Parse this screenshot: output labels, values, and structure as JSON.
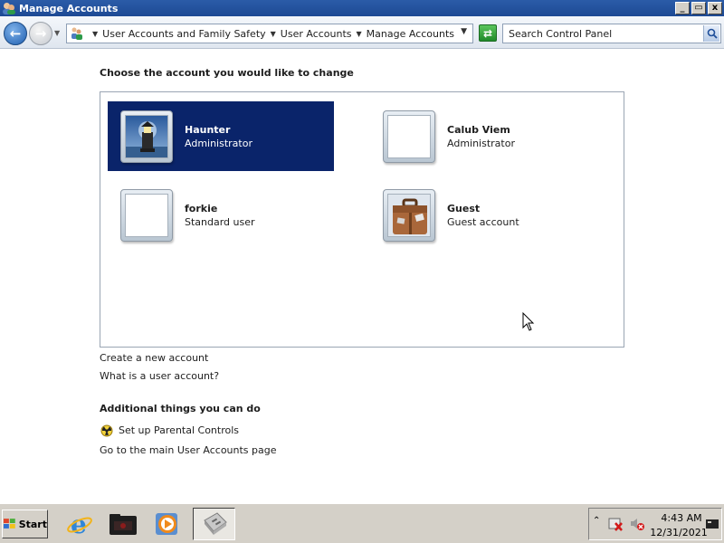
{
  "window": {
    "title": "Manage Accounts",
    "controls": {
      "minimize": "_",
      "restore": "▭",
      "close": "x"
    }
  },
  "address": {
    "breadcrumbs": [
      "User Accounts and Family Safety",
      "User Accounts",
      "Manage Accounts"
    ],
    "search_placeholder": "Search Control Panel"
  },
  "main": {
    "heading": "Choose the account you would like to change",
    "accounts": [
      {
        "name": "Haunter",
        "type": "Administrator",
        "picture": "lighthouse",
        "selected": true
      },
      {
        "name": "Calub Viem",
        "type": "Administrator",
        "picture": "blank",
        "selected": false
      },
      {
        "name": "forkie",
        "type": "Standard user",
        "picture": "blank",
        "selected": false
      },
      {
        "name": "Guest",
        "type": "Guest account",
        "picture": "suitcase",
        "selected": false
      }
    ],
    "links": {
      "create_account": "Create a new account",
      "what_is": "What is a user account?"
    },
    "additional": {
      "heading": "Additional things you can do",
      "parental_controls": "Set up Parental Controls",
      "main_page": "Go to the main User Accounts page"
    }
  },
  "taskbar": {
    "start_label": "Start",
    "clock_time": "4:43 AM",
    "clock_date": "12/31/2021"
  },
  "colors": {
    "selected_bg": "#0a246a",
    "title_bar": "#2b5ca8",
    "taskbar": "#d4d0c8"
  }
}
